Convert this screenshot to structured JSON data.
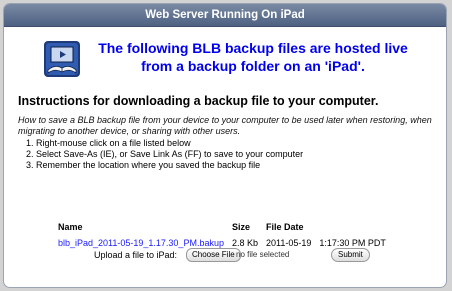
{
  "window": {
    "title": "Web Server Running On iPad"
  },
  "hero": {
    "icon": "book-app-icon",
    "line1": "The following BLB backup files are hosted live",
    "line2": "from a backup folder on an 'iPad'."
  },
  "instructions": {
    "title": "Instructions for downloading a backup file to your computer.",
    "description": "How to save a BLB backup file from your device to your computer to be used later when restoring, when migrating to another device, or sharing with other users.",
    "steps": [
      "1.  Right-mouse click on a file listed below",
      "2.  Select Save-As (IE), or Save Link As (FF) to save to your computer",
      "3.  Remember the location where you saved the backup file"
    ]
  },
  "files": {
    "headers": {
      "name": "Name",
      "size": "Size",
      "date": "File Date"
    },
    "rows": [
      {
        "name": "blb_iPad_2011-05-19_1.17.30_PM.bakup",
        "size": "2.8 Kb",
        "date": "2011-05-19",
        "time": "1:17:30 PM PDT"
      }
    ]
  },
  "upload": {
    "label": "Upload a file to iPad:",
    "choose_label": "Choose File",
    "no_file_text": "no file selected",
    "submit_label": "Submit"
  },
  "colors": {
    "hero_text": "#0000ee",
    "link": "#1a1aff",
    "titlebar": "#5a6c8c"
  }
}
